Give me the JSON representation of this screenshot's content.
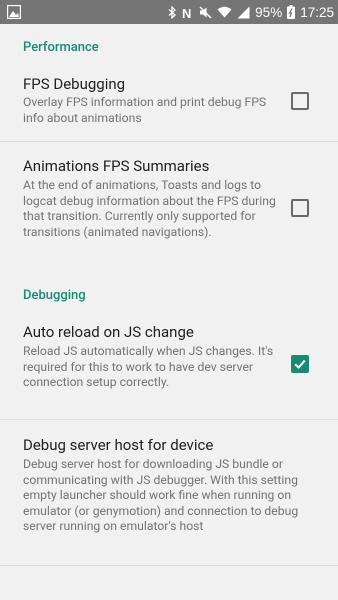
{
  "status_bar": {
    "battery_percent": "95%",
    "time": "17:25"
  },
  "sections": [
    {
      "category": "Performance",
      "items": [
        {
          "title": "FPS Debugging",
          "summary": "Overlay FPS information and print debug FPS info about animations",
          "checked": false
        },
        {
          "title": "Animations FPS Summaries",
          "summary": "At the end of animations, Toasts and logs to logcat debug information about the FPS during that transition. Currently only supported for transitions (animated navigations).",
          "checked": false
        }
      ]
    },
    {
      "category": "Debugging",
      "items": [
        {
          "title": "Auto reload on JS change",
          "summary": "Reload JS automatically when JS changes. It's required for this to work to have dev server connection setup correctly.",
          "checked": true
        },
        {
          "title": "Debug server host for device",
          "summary": "Debug server host for downloading JS bundle or communicating with JS debugger. With this setting empty launcher should work fine when running on emulator (or genymotion) and connection to debug server running on emulator's host"
        }
      ]
    }
  ],
  "colors": {
    "accent": "#1b8a73",
    "status_bar": "#757575",
    "background": "#f1f1f1"
  }
}
